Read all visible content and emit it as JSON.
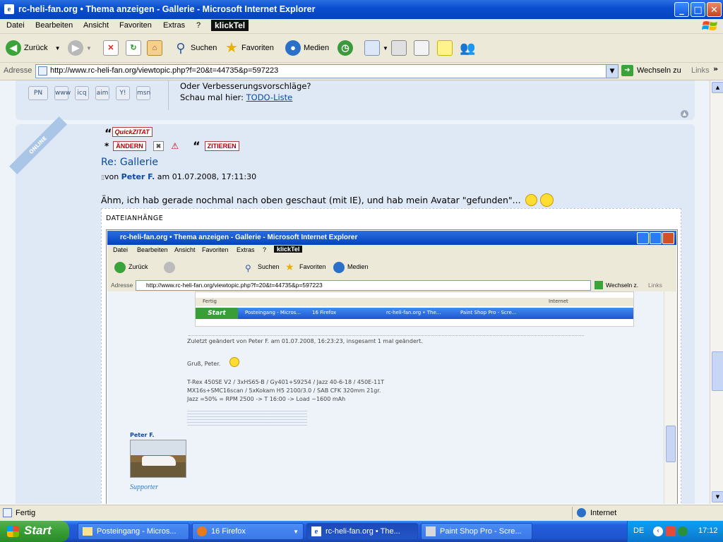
{
  "window": {
    "title": "rc-heli-fan.org • Thema anzeigen - Gallerie - Microsoft Internet Explorer",
    "buttons": {
      "minimize": "_",
      "maximize": "□",
      "close": "✕"
    }
  },
  "menu": {
    "items": [
      "Datei",
      "Bearbeiten",
      "Ansicht",
      "Favoriten",
      "Extras",
      "?"
    ],
    "klicktel": "klickTel"
  },
  "toolbar": {
    "back": "Zurück",
    "search": "Suchen",
    "favorites": "Favoriten",
    "media": "Medien"
  },
  "address": {
    "label": "Adresse",
    "url": "http://www.rc-heli-fan.org/viewtopic.php?f=20&t=44735&p=597223",
    "go": "Wechseln zu",
    "links": "Links"
  },
  "prev_post": {
    "line1": "Oder Verbesserungsvorschläge?",
    "line2": "Schau mal hier: ",
    "link": "TODO-Liste",
    "icons": [
      "PN",
      "www",
      "icq",
      "aim",
      "Y!",
      "msn"
    ]
  },
  "post": {
    "online_badge": "ONLINE",
    "quick_quote": "QuickZITAT",
    "edit": "ÄNDERN",
    "quote": "ZITIEREN",
    "title": "Re: Gallerie",
    "by_prefix": "von ",
    "author": "Peter F.",
    "date": " am 01.07.2008, 17:11:30",
    "body": "Ähm, ich hab gerade nochmal nach oben geschaut (mit IE), und hab mein Avatar \"gefunden\"...",
    "attachments_label": "DATEIANHÄNGE"
  },
  "nested": {
    "title": "rc-heli-fan.org • Thema anzeigen - Gallerie - Microsoft Internet Explorer",
    "menu": [
      "Datei",
      "Bearbeiten",
      "Ansicht",
      "Favoriten",
      "Extras",
      "?"
    ],
    "klicktel": "klickTel",
    "back": "Zurück",
    "search": "Suchen",
    "favorites": "Favoriten",
    "media": "Medien",
    "addr_label": "Adresse",
    "url": "http://www.rc-heli-fan.org/viewtopic.php?f=20&t=44735&p=597223",
    "go": "Wechseln z.",
    "links": "Links",
    "inner_status_left": "Fertig",
    "inner_status_right": "Internet",
    "inner_start": "Start",
    "inner_tasks": [
      "Posteingang - Micros...",
      "16 Firefox",
      "rc-heli-fan.org • The...",
      "Paint Shop Pro - Scre..."
    ],
    "edited": "Zuletzt geändert von Peter F. am 01.07.2008, 16:23:23, insgesamt 1 mal geändert.",
    "greeting": "Gruß, Peter.",
    "sig1": "T-Rex 450SE V2 / 3xHS65-B / Gy401+S9254 / Jazz 40-6-18 / 450E-11T",
    "sig2": "MX16s+SMC16scan / 5xKokam H5 2100/3.0 / SAB CFK 320mm 21gr.",
    "sig3": "Jazz =50% = RPM 2500 -> T 16:00 -> Load ~1600 mAh",
    "author_name": "Peter F.",
    "supporter": "Supporter"
  },
  "status": {
    "left": "Fertig",
    "right": "Internet"
  },
  "taskbar": {
    "start": "Start",
    "tasks": [
      "Posteingang - Micros...",
      "16 Firefox",
      "rc-heli-fan.org • The...",
      "Paint Shop Pro - Scre..."
    ],
    "lang": "DE",
    "clock": "17:12"
  },
  "colors": {
    "accent": "#0c4aa0",
    "xp_blue": "#0a4fd0",
    "start_green": "#389e35"
  }
}
